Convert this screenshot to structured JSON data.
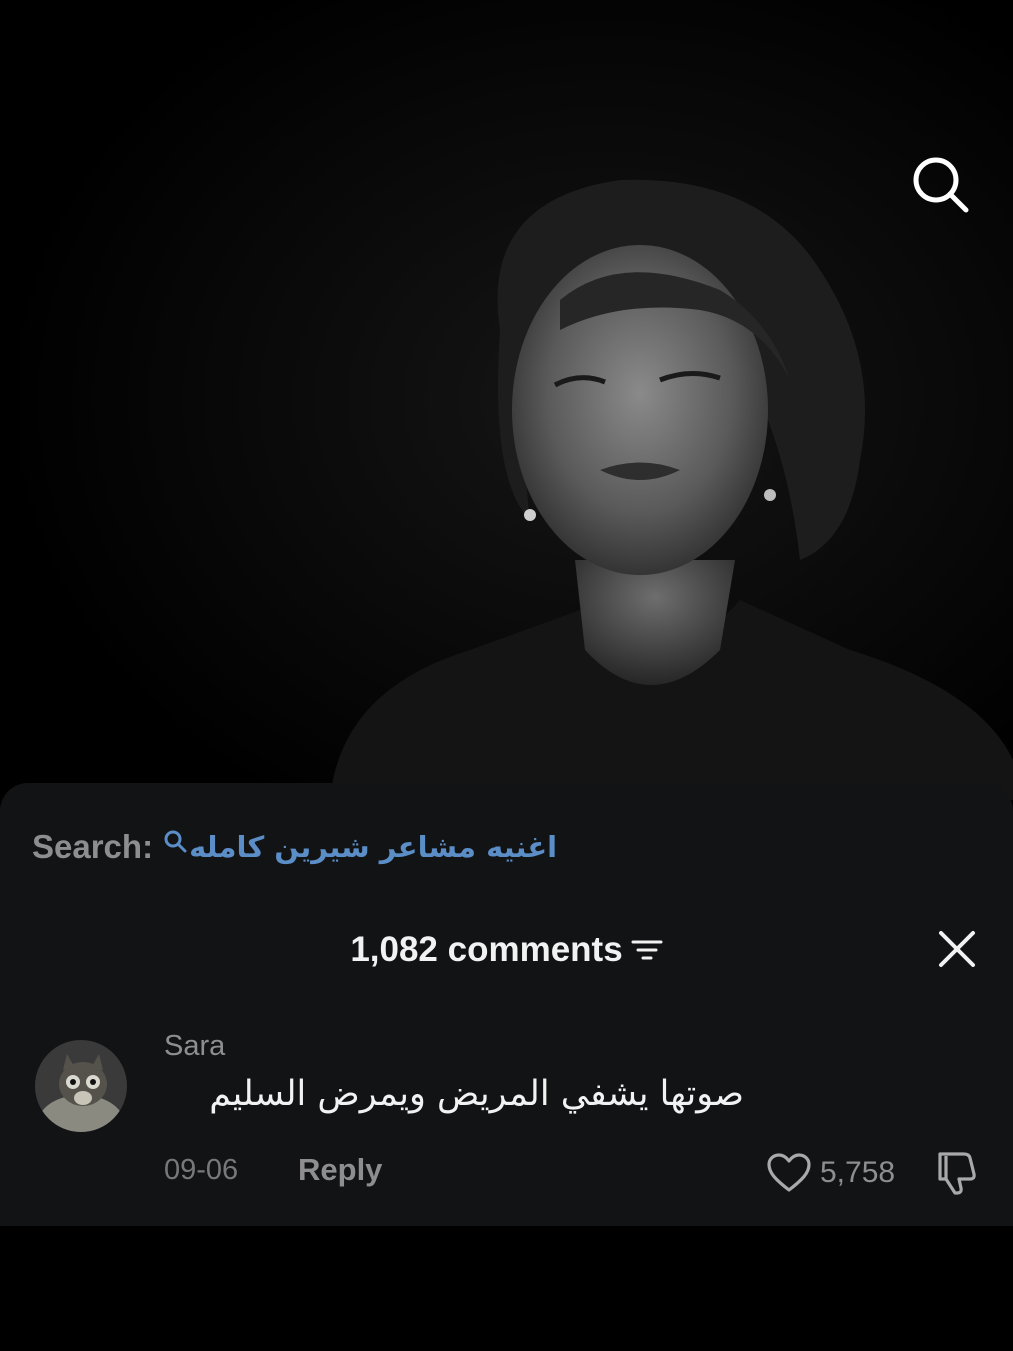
{
  "video": {
    "search_icon": "search-icon"
  },
  "search": {
    "label": "Search:",
    "term": "اغنيه مشاعر شيرين كامله",
    "link_color": "#5b8dc7",
    "icon": "search-icon"
  },
  "comments_panel": {
    "count_label": "1,082 comments",
    "sort_icon": "sort-lines-icon",
    "close_icon": "close-icon",
    "background": "#121314"
  },
  "comments": [
    {
      "username": "Sara",
      "text": "صوتها يشفي المريض ويمرض السليم",
      "date": "09-06",
      "reply_label": "Reply",
      "likes": "5,758",
      "like_icon": "heart-icon",
      "dislike_icon": "thumbs-down-icon"
    }
  ]
}
